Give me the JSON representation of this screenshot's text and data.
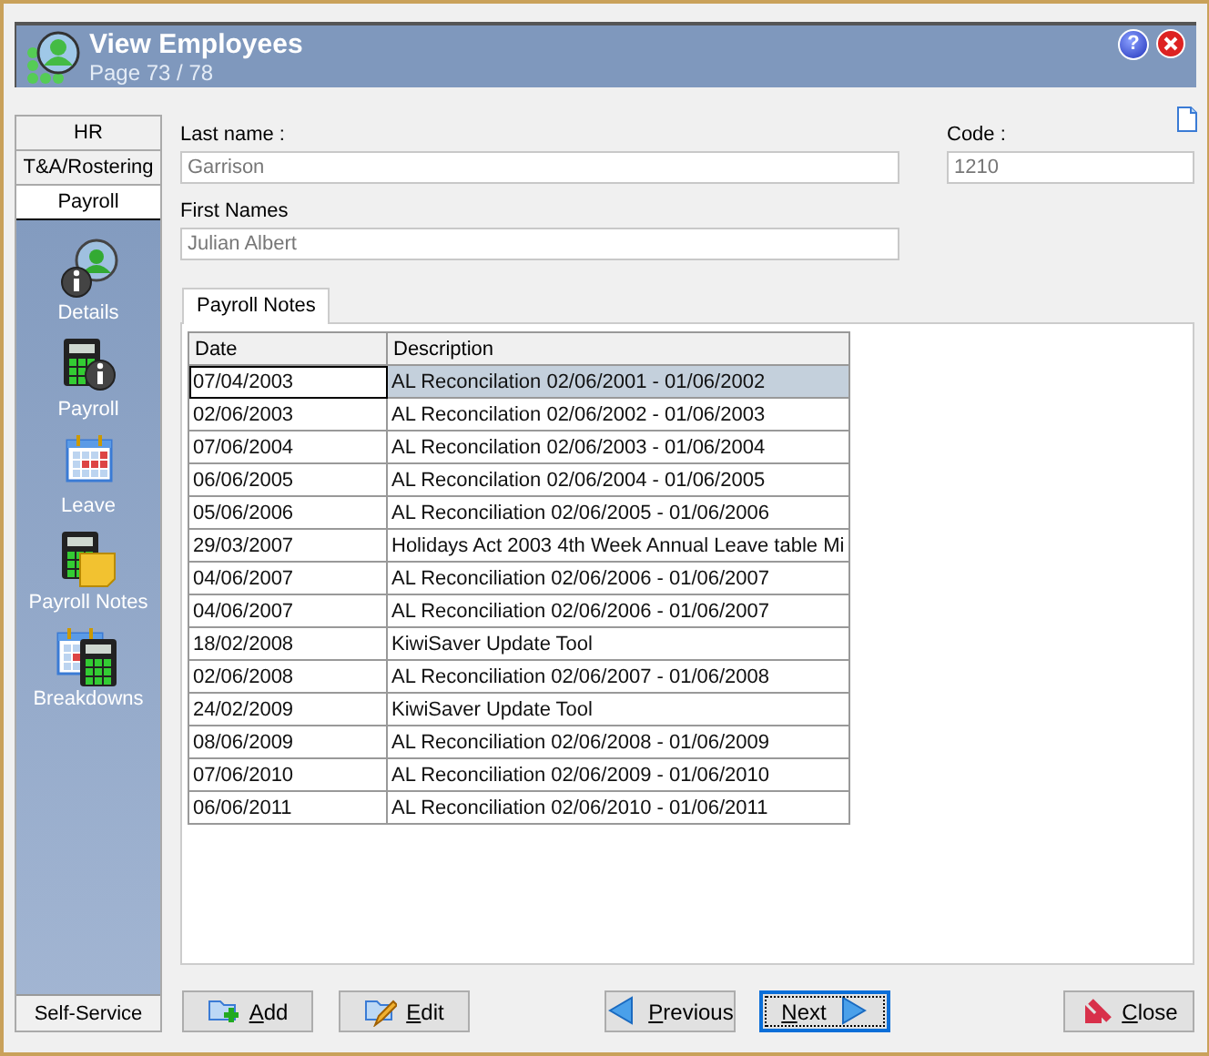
{
  "window": {
    "title": "View Employees",
    "subtitle": "Page 73 / 78",
    "help": "?"
  },
  "sidebar": {
    "tabs": [
      {
        "label": "HR",
        "selected": false
      },
      {
        "label": "T&A/Rostering",
        "selected": false
      },
      {
        "label": "Payroll",
        "selected": true
      }
    ],
    "items": [
      {
        "label": "Details",
        "kind": "details"
      },
      {
        "label": "Payroll",
        "kind": "payroll"
      },
      {
        "label": "Leave",
        "kind": "leave"
      },
      {
        "label": "Payroll Notes",
        "kind": "notes"
      },
      {
        "label": "Breakdowns",
        "kind": "breakdowns"
      }
    ],
    "footer": "Self-Service"
  },
  "form": {
    "last_name": {
      "label": "Last name :",
      "value": "Garrison"
    },
    "code": {
      "label": "Code :",
      "value": "1210"
    },
    "first_names": {
      "label": "First Names",
      "value": "Julian Albert"
    }
  },
  "tabs": [
    {
      "label": "Payroll Notes",
      "selected": true
    }
  ],
  "table": {
    "columns": [
      "Date",
      "Description"
    ],
    "rows": [
      {
        "date": "07/04/2003",
        "description": "AL Reconcilation 02/06/2001 - 01/06/2002",
        "selected": true
      },
      {
        "date": "02/06/2003",
        "description": "AL Reconcilation 02/06/2002 - 01/06/2003",
        "selected": false
      },
      {
        "date": "07/06/2004",
        "description": "AL Reconcilation 02/06/2003 - 01/06/2004",
        "selected": false
      },
      {
        "date": "06/06/2005",
        "description": "AL Reconcilation 02/06/2004 - 01/06/2005",
        "selected": false
      },
      {
        "date": "05/06/2006",
        "description": "AL Reconciliation  02/06/2005 - 01/06/2006",
        "selected": false
      },
      {
        "date": "29/03/2007",
        "description": "Holidays Act 2003 4th Week Annual Leave table Mi",
        "selected": false
      },
      {
        "date": "04/06/2007",
        "description": "AL Reconciliation  02/06/2006 - 01/06/2007",
        "selected": false
      },
      {
        "date": "04/06/2007",
        "description": "AL Reconciliation  02/06/2006 - 01/06/2007",
        "selected": false
      },
      {
        "date": "18/02/2008",
        "description": "KiwiSaver Update Tool",
        "selected": false
      },
      {
        "date": "02/06/2008",
        "description": "AL Reconciliation  02/06/2007 - 01/06/2008",
        "selected": false
      },
      {
        "date": "24/02/2009",
        "description": "KiwiSaver Update Tool",
        "selected": false
      },
      {
        "date": "08/06/2009",
        "description": "AL Reconciliation  02/06/2008 - 01/06/2009",
        "selected": false
      },
      {
        "date": "07/06/2010",
        "description": "AL Reconciliation  02/06/2009 - 01/06/2010",
        "selected": false
      },
      {
        "date": "06/06/2011",
        "description": "AL Reconciliation  02/06/2010 - 01/06/2011",
        "selected": false
      }
    ]
  },
  "buttons": [
    {
      "label": "Add",
      "kind": "add",
      "focused": false
    },
    {
      "label": "Edit",
      "kind": "edit",
      "focused": false
    },
    {
      "label": "Previous",
      "kind": "previous",
      "focused": false
    },
    {
      "label": "Next",
      "kind": "next",
      "focused": true
    },
    {
      "label": "Close",
      "kind": "close",
      "focused": false
    }
  ]
}
